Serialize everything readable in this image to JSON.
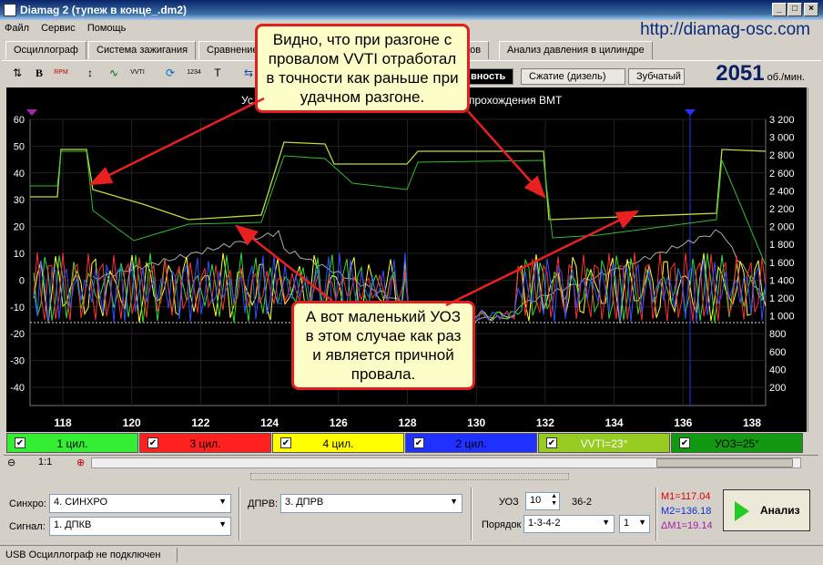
{
  "window": {
    "title": "Diamag 2 (тупеж в конце_.dm2)",
    "min": "_",
    "max": "□",
    "close": "×"
  },
  "menu": [
    "Файл",
    "Сервис",
    "Помощь"
  ],
  "url": "http://diamag-osc.com",
  "tabs": [
    "Осциллограф",
    "Система зажигания",
    "Сравнение",
    "ров",
    "Анализ давления в цилиндре"
  ],
  "subtabs": [
    "вность",
    "Сжатие (дизель)",
    "Зубчатый"
  ],
  "toolbar": [
    "⇅",
    "B",
    "RPM",
    "↕",
    "VVTI",
    "1234",
    "T"
  ],
  "rpm": {
    "value": "2051",
    "unit": "об./мин."
  },
  "chart": {
    "title_left": "Ус",
    "title_right": "прохождения ВМТ",
    "y_left": [
      "60",
      "50",
      "40",
      "30",
      "20",
      "10",
      "0",
      "-10",
      "-20",
      "-30",
      "-40"
    ],
    "y_right": [
      "3 200",
      "3 000",
      "2 800",
      "2 600",
      "2 400",
      "2 200",
      "2 000",
      "1 800",
      "1 600",
      "1 400",
      "1 200",
      "1 000",
      "800",
      "600",
      "400",
      "200"
    ],
    "x": [
      "118",
      "120",
      "122",
      "124",
      "126",
      "128",
      "130",
      "132",
      "134",
      "136",
      "138"
    ]
  },
  "chart_data": {
    "type": "line",
    "x_label_ticks": [
      118,
      120,
      122,
      124,
      126,
      128,
      130,
      132,
      134,
      136,
      138
    ],
    "ylim_left": [
      -48,
      60
    ],
    "ylim_right": [
      0,
      3300
    ],
    "cursors": {
      "m1": 117.04,
      "m2": 136.18
    },
    "series": [
      {
        "name": "VVTI=23°",
        "color": "#9acd32"
      },
      {
        "name": "УОЗ=25°",
        "color": "#22aa22"
      },
      {
        "name": "1 цил.",
        "color": "#33dd33"
      },
      {
        "name": "3 цил.",
        "color": "#ff3030"
      },
      {
        "name": "4 цил.",
        "color": "#ffff33"
      },
      {
        "name": "2 цил.",
        "color": "#3050ff"
      }
    ]
  },
  "channels": [
    {
      "label": "1 цил.",
      "color": "#33ee33"
    },
    {
      "label": "3 цил.",
      "color": "#ff2020"
    },
    {
      "label": "4 цил.",
      "color": "#ffff00"
    },
    {
      "label": "2 цил.",
      "color": "#2030ff"
    },
    {
      "label": "VVTI=23°",
      "color": "#99cc22"
    },
    {
      "label": "УОЗ=25°",
      "color": "#119911"
    }
  ],
  "zoom": {
    "value": "1:1",
    "minus": "⊖",
    "plus": "⊕"
  },
  "bottom": {
    "sync_label": "Синхро:",
    "sync_value": "4. СИНХРО",
    "signal_label": "Сигнал:",
    "signal_value": "1. ДПКВ",
    "dprv_label": "ДПРВ:",
    "dprv_value": "3. ДПРВ",
    "uoz_label": "УОЗ",
    "uoz_value": "10",
    "teeth": "36-2",
    "order_label": "Порядок",
    "order_value": "1-3-4-2",
    "cyl_value": "1",
    "m1": "M1=117.04",
    "m2": "M2=136.18",
    "dm1": "ΔM1=19.14",
    "analyze": "Анализ"
  },
  "status": "USB Осциллограф не подключен",
  "callouts": [
    "Видно, что при разгоне с провалом VVTI отработал в точности как раньше при удачном разгоне.",
    "А вот маленький УОЗ в этом случае как раз и является причной провала."
  ]
}
